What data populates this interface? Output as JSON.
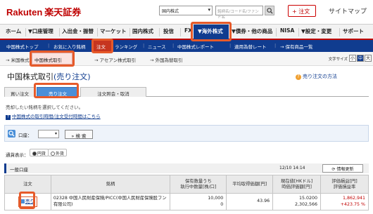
{
  "header": {
    "logo_en": "Rakuten",
    "logo_jp": "楽天証券",
    "market_select": "国内株式",
    "search_placeholder": "銘柄名/コード名/ファンド名",
    "order_button": "注文",
    "sitemap": "サイトマップ"
  },
  "global_nav": [
    "ホーム",
    "▼口座管理",
    "入出金・振替",
    "マーケット",
    "国内株式",
    "投信",
    "FX",
    "▼海外株式",
    "▼債券・他の商品",
    "NISA",
    "▼設定・変更",
    "サポート"
  ],
  "global_nav_active": "▼海外株式",
  "sub_nav": [
    "中国株式トップ",
    "お気に入り銘柄",
    "注文",
    "ランキング",
    "ニュース",
    "中国株式レポート",
    "適用為替レート",
    "→ 保有商品一覧"
  ],
  "sub_nav_active": "注文",
  "tabs": [
    "→ 米国株式取引",
    "中国株式取引",
    "→ アセアン株式取引",
    "→ 外国為替取引"
  ],
  "tab_active": "中国株式取引",
  "font_size": {
    "label": "文字サイズ",
    "small": "小",
    "medium": "中",
    "large": "大"
  },
  "page": {
    "title": "中国株式取引",
    "title_sub": "(売り注文)",
    "howto": "売り注文の方法",
    "howto_icon": "?"
  },
  "order_tabs": [
    "買い注文",
    "売り注文",
    "注文照会・取消"
  ],
  "order_tab_active": "売り注文",
  "hint": "売却したい銘柄を選択してください。",
  "hint_link": "中国株式の取引時間/注文受付時間はこちら",
  "hint_link_icon": "?",
  "filter": {
    "label": "口座：",
    "select_value": "",
    "search_button": "検 索"
  },
  "currency_display": {
    "label": "通貨表示：",
    "options": [
      "円貨",
      "外貨"
    ],
    "selected": "円貨"
  },
  "section": {
    "label": "一般口座",
    "datetime": "12/10 14:14",
    "refresh_button": "情報更新"
  },
  "table": {
    "columns": [
      "注文",
      "銘柄",
      "保有数量うち\n執行中数量[株/口]",
      "平均取得価額[円]",
      "現在値[HKドル]\n時価評価額[円]",
      "評価損益[円]\n評価損益率"
    ],
    "rows": [
      {
        "order": "売り",
        "name": "02328 中国人民財産保険/PICC(中国人民財産保険股フン有限公司)",
        "qty": "10,000",
        "qty_executing": "0",
        "avg_price": "43.96",
        "current_price": "15.0200",
        "market_value": "2,302,566",
        "pl": "1,862,941",
        "pl_rate": "+423.75 %"
      }
    ]
  },
  "colors": {
    "brand_red": "#bf0000",
    "nav_blue": "#103c8f",
    "highlight_orange": "#e65a2a",
    "tab_blue": "#4a8fd8"
  }
}
